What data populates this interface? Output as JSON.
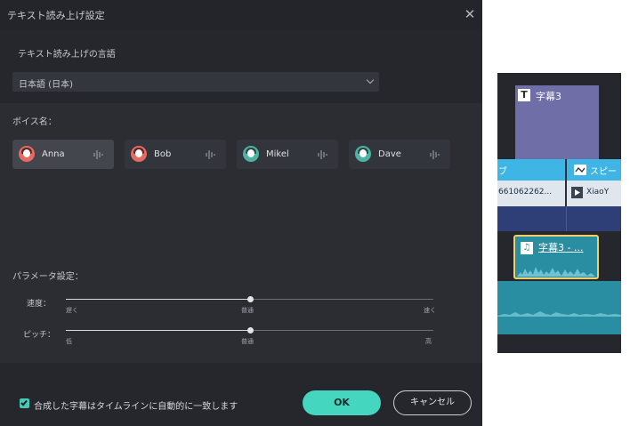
{
  "dialog": {
    "title": "テキスト読み上げ設定",
    "close_icon": "close-icon"
  },
  "language": {
    "label": "テキスト読み上げの言語",
    "selected": "日本語 (日本)"
  },
  "voices": {
    "label": "ボイス名：",
    "items": [
      {
        "name": "Anna",
        "gender": "female",
        "selected": true
      },
      {
        "name": "Bob",
        "gender": "female",
        "selected": false
      },
      {
        "name": "Mikel",
        "gender": "male",
        "selected": false
      },
      {
        "name": "Dave",
        "gender": "male",
        "selected": false
      }
    ]
  },
  "parameters": {
    "label": "パラメータ設定：",
    "speed": {
      "label": "速度：",
      "min_label": "遅く",
      "mid_label": "普通",
      "max_label": "速く",
      "value": 0.5
    },
    "pitch": {
      "label": "ピッチ：",
      "min_label": "低",
      "mid_label": "普通",
      "max_label": "高",
      "value": 0.5
    }
  },
  "footer": {
    "checkbox_label": "合成した字幕はタイムラインに自動的に一致します",
    "checked": true,
    "ok_label": "OK",
    "cancel_label": "キャンセル"
  },
  "timeline": {
    "title_clip_label": "字幕3",
    "effect_clip_label": "ブ",
    "effect_clip2_label": "スピー",
    "video_clip_label": "661062262...",
    "video_clip2_label": "XiaoY",
    "audio_clip_label": "字幕3 - ..."
  },
  "colors": {
    "accent": "#45d6bf",
    "selection": "#f0cf6b",
    "title_clip": "#6f6ea6",
    "effect_track": "#3fb5e6",
    "audio_track": "#2a8ea3"
  }
}
